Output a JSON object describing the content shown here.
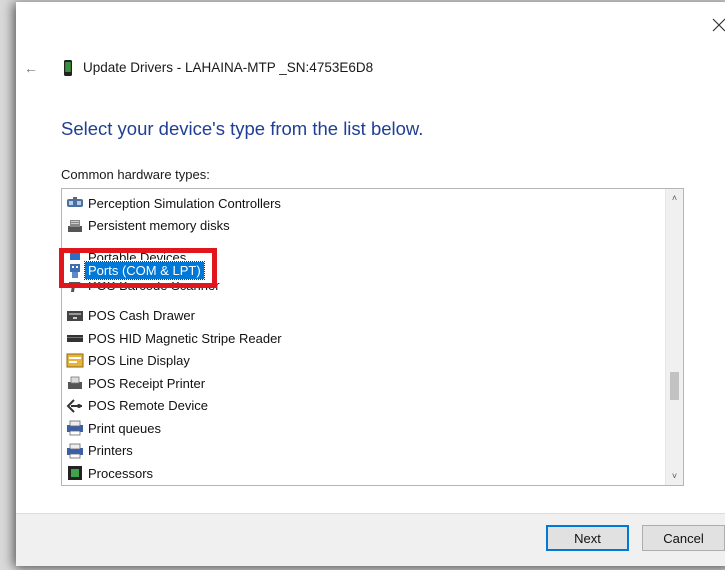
{
  "window": {
    "title": "Update Drivers - LAHAINA-MTP _SN:4753E6D8",
    "back_glyph": "←",
    "close_icon": "close-icon"
  },
  "main": {
    "heading": "Select your device's type from the list below.",
    "list_label": "Common hardware types:"
  },
  "list": {
    "items": [
      {
        "label": "Perception Simulation Controllers",
        "icon": "vr-headset-icon"
      },
      {
        "label": "Persistent memory disks",
        "icon": "memory-disk-icon"
      },
      {
        "label": "Portable Devices",
        "icon": "portable-device-icon"
      },
      {
        "label": "Ports (COM & LPT)",
        "icon": "port-connector-icon",
        "selected": true
      },
      {
        "label": "POS Barcode Scanner",
        "icon": "barcode-scanner-icon"
      },
      {
        "label": "POS Cash Drawer",
        "icon": "cash-drawer-icon"
      },
      {
        "label": "POS HID Magnetic Stripe Reader",
        "icon": "card-reader-icon"
      },
      {
        "label": "POS Line Display",
        "icon": "line-display-icon"
      },
      {
        "label": "POS Receipt Printer",
        "icon": "receipt-printer-icon"
      },
      {
        "label": "POS Remote Device",
        "icon": "remote-device-icon"
      },
      {
        "label": "Print queues",
        "icon": "print-queue-icon"
      },
      {
        "label": "Printers",
        "icon": "printer-icon"
      },
      {
        "label": "Processors",
        "icon": "processor-icon"
      }
    ]
  },
  "buttons": {
    "next": "Next",
    "cancel": "Cancel"
  },
  "colors": {
    "heading": "#1f3e94",
    "selection": "#0078d7",
    "highlight": "#e0161c"
  }
}
